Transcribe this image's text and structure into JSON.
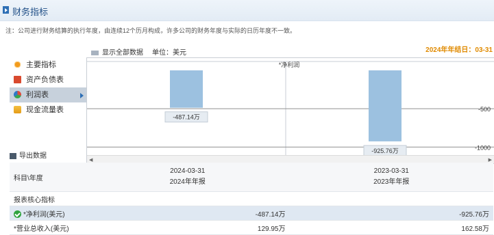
{
  "header": {
    "title": "财务指标"
  },
  "note": "注：公司进行财务结算的执行年度，由连续12个历月构成，许多公司的财务年度与实际的日历年度不一致。",
  "fiscal_year_end": "2024年年结日：03-31",
  "toolbar": {
    "show_all": "显示全部数据",
    "unit": "单位：美元"
  },
  "sidebar": {
    "items": [
      {
        "label": "主要指标",
        "icon": "sun-icon"
      },
      {
        "label": "资产负债表",
        "icon": "document-icon"
      },
      {
        "label": "利润表",
        "icon": "pie-chart-icon"
      },
      {
        "label": "现金流量表",
        "icon": "cash-icon"
      }
    ]
  },
  "export_label": "导出数据",
  "chart_data": {
    "type": "bar",
    "title": "*净利润",
    "categories": [
      "2024-03-31",
      "2023-03-31"
    ],
    "values": [
      -4871400,
      -9257600
    ],
    "data_labels": [
      "-487.14万",
      "-925.76万"
    ],
    "yticks": [
      {
        "value": -5000000,
        "label": "-500"
      },
      {
        "value": -10000000,
        "label": "-1000"
      }
    ],
    "ylim": [
      -11400000,
      0
    ],
    "color": "#9cc1e0"
  },
  "table": {
    "header_label": "科目\\年度",
    "periods": [
      {
        "date": "2024-03-31",
        "report": "2024年年报"
      },
      {
        "date": "2023-03-31",
        "report": "2023年年报"
      }
    ],
    "section_label": "报表核心指标",
    "rows": [
      {
        "label": "*净利润(美元)",
        "values": [
          "-487.14万",
          "-925.76万"
        ]
      },
      {
        "label": "*营业总收入(美元)",
        "values": [
          "129.95万",
          "162.58万"
        ]
      }
    ]
  }
}
